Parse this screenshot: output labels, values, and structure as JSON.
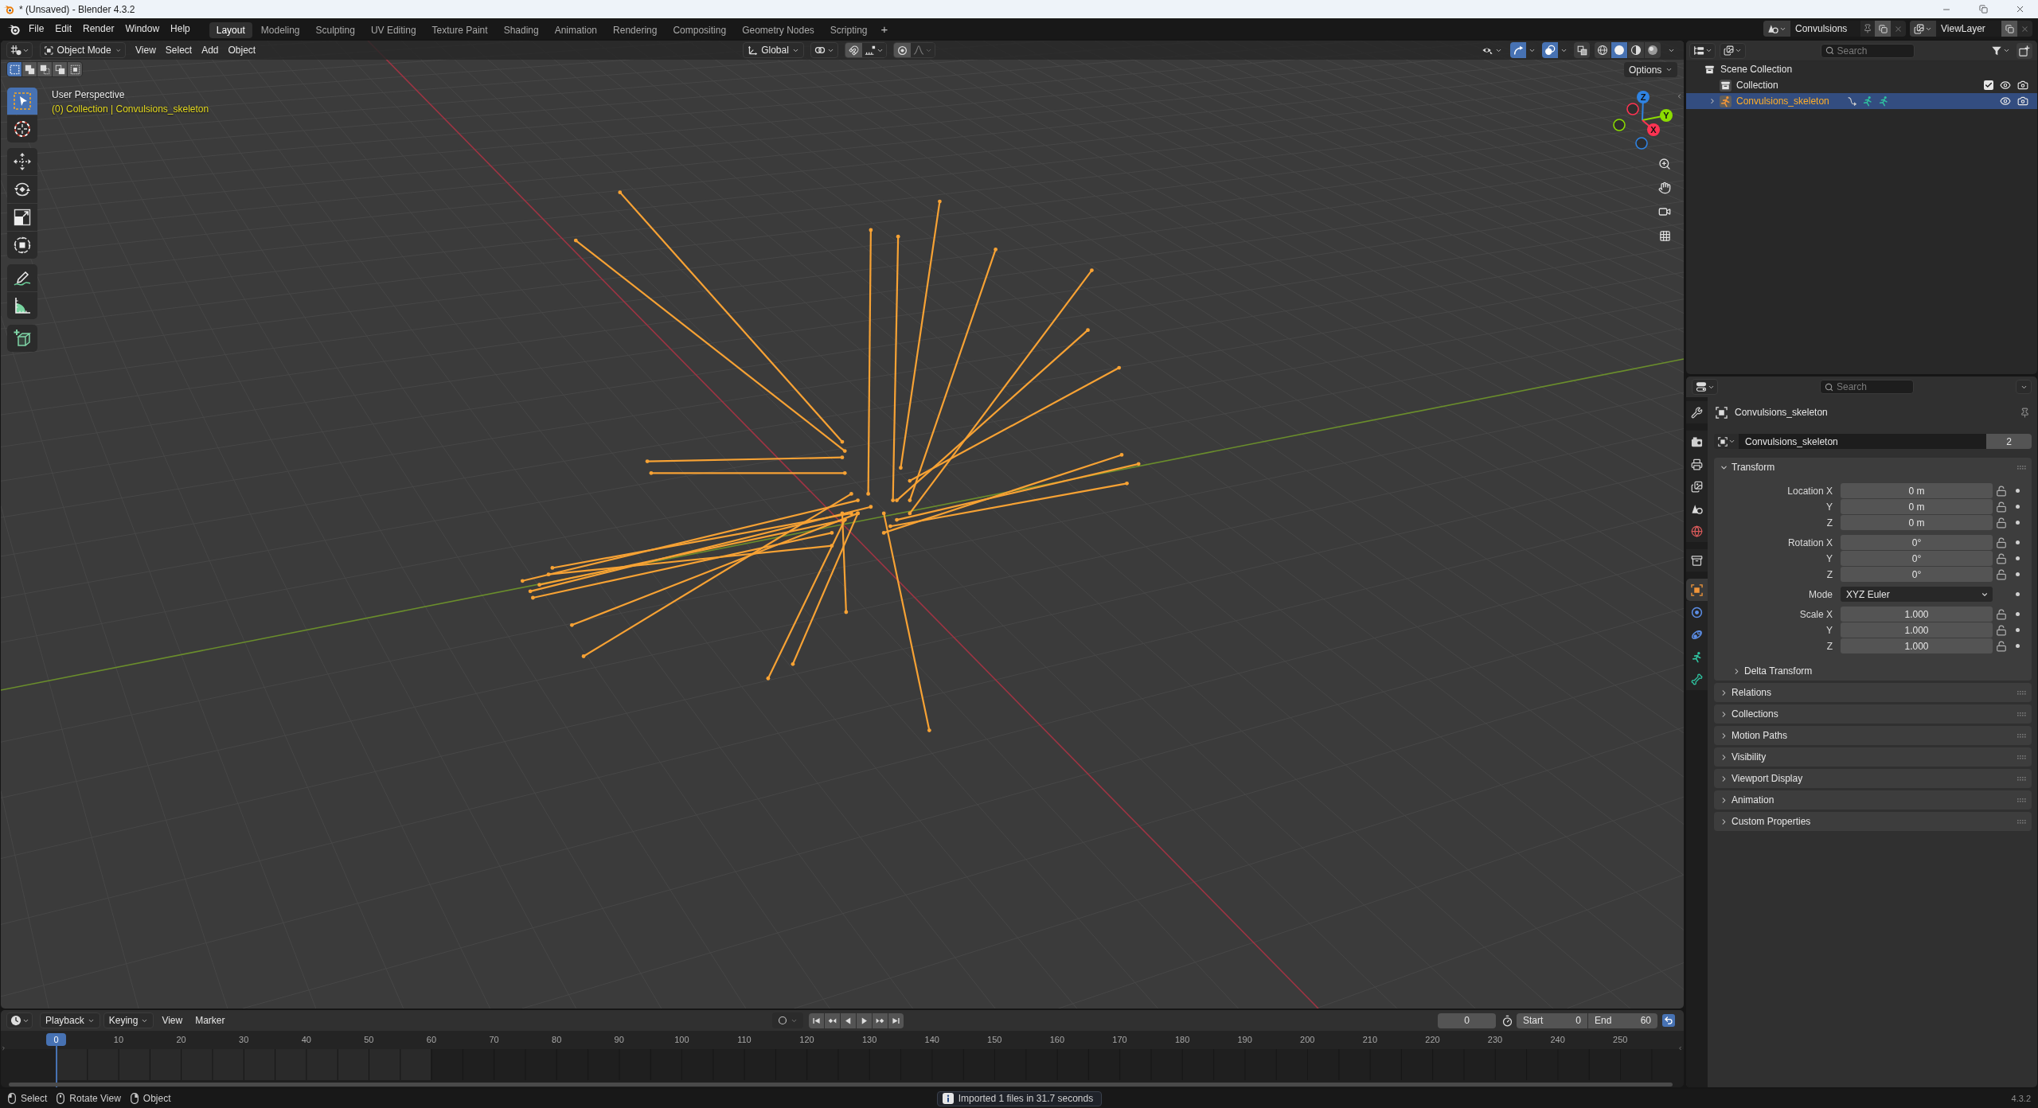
{
  "title_bar": {
    "title": "* (Unsaved) - Blender 4.3.2"
  },
  "top_bar": {
    "menus": [
      "File",
      "Edit",
      "Render",
      "Window",
      "Help"
    ],
    "workspaces": [
      {
        "label": "Layout",
        "selected": true
      },
      {
        "label": "Modeling",
        "selected": false
      },
      {
        "label": "Sculpting",
        "selected": false
      },
      {
        "label": "UV Editing",
        "selected": false
      },
      {
        "label": "Texture Paint",
        "selected": false
      },
      {
        "label": "Shading",
        "selected": false
      },
      {
        "label": "Animation",
        "selected": false
      },
      {
        "label": "Rendering",
        "selected": false
      },
      {
        "label": "Compositing",
        "selected": false
      },
      {
        "label": "Geometry Nodes",
        "selected": false
      },
      {
        "label": "Scripting",
        "selected": false
      }
    ],
    "add_workspace": "+",
    "scene": "Convulsions",
    "view_layer": "ViewLayer"
  },
  "viewport": {
    "header": {
      "mode": "Object Mode",
      "menus": [
        "View",
        "Select",
        "Add",
        "Object"
      ],
      "orientation": "Global",
      "gizmos_on": true,
      "overlays_on": true,
      "shading": [
        {
          "kind": "wireframe",
          "selected": false
        },
        {
          "kind": "solid",
          "selected": true
        },
        {
          "kind": "material",
          "selected": false
        },
        {
          "kind": "rendered",
          "selected": false
        }
      ]
    },
    "selection_modes": [
      {
        "kind": "set",
        "selected": true
      },
      {
        "kind": "extend",
        "selected": false
      },
      {
        "kind": "subtract",
        "selected": false
      },
      {
        "kind": "invert",
        "selected": false
      },
      {
        "kind": "intersect",
        "selected": false
      }
    ],
    "options": "Options",
    "view_name": "User Perspective",
    "context": "(0) Collection | Convulsions_skeleton",
    "tool_groups": [
      {
        "tools": [
          {
            "kind": "select_box",
            "selected": true
          },
          {
            "kind": "cursor",
            "selected": false
          }
        ]
      },
      {
        "tools": [
          {
            "kind": "move",
            "selected": false
          },
          {
            "kind": "rotate",
            "selected": false
          },
          {
            "kind": "scale",
            "selected": false
          },
          {
            "kind": "transform",
            "selected": false
          }
        ]
      },
      {
        "tools": [
          {
            "kind": "annotate",
            "selected": false
          },
          {
            "kind": "measure",
            "selected": false
          }
        ]
      },
      {
        "tools": [
          {
            "kind": "add_cube",
            "selected": false
          }
        ]
      }
    ],
    "gizmo_axes": [
      {
        "label": "Z",
        "color": "#2f83e2"
      },
      {
        "label": "Y",
        "color": "#8bdc00"
      },
      {
        "label": "X",
        "color": "#ff3352"
      }
    ]
  },
  "outliner": {
    "search_placeholder": "Search",
    "tree": [
      {
        "kind": "scene_collection",
        "label": "Scene Collection",
        "selected": false,
        "children": [
          {
            "kind": "collection",
            "label": "Collection",
            "checked": true,
            "selected": false
          },
          {
            "kind": "armature",
            "label": "Convulsions_skeleton",
            "selected": true,
            "expanded": false
          }
        ]
      }
    ]
  },
  "properties": {
    "search_placeholder": "Search",
    "tab_groups": [
      {
        "tabs": [
          {
            "kind": "tool",
            "selected": false
          }
        ]
      },
      {
        "tabs": [
          {
            "kind": "render",
            "selected": false
          },
          {
            "kind": "output",
            "selected": false
          },
          {
            "kind": "view_layer",
            "selected": false
          },
          {
            "kind": "scene",
            "selected": false
          },
          {
            "kind": "world",
            "selected": false
          }
        ]
      },
      {
        "tabs": [
          {
            "kind": "collection",
            "selected": false
          }
        ]
      },
      {
        "tabs": [
          {
            "kind": "object",
            "selected": true
          },
          {
            "kind": "physics",
            "selected": false
          },
          {
            "kind": "constraints",
            "selected": false
          },
          {
            "kind": "armature_data",
            "selected": false
          },
          {
            "kind": "bone",
            "selected": false
          }
        ]
      }
    ],
    "object_name": "Convulsions_skeleton",
    "datablock": {
      "name": "Convulsions_skeleton",
      "users": "2"
    },
    "panels": [
      {
        "title": "Transform",
        "expanded": true,
        "groups": [
          {
            "kind": "number",
            "rows": [
              {
                "label": "Location X",
                "value": "0 m"
              },
              {
                "label": "Y",
                "value": "0 m"
              },
              {
                "label": "Z",
                "value": "0 m"
              }
            ]
          },
          {
            "kind": "number",
            "rows": [
              {
                "label": "Rotation X",
                "value": "0°"
              },
              {
                "label": "Y",
                "value": "0°"
              },
              {
                "label": "Z",
                "value": "0°"
              }
            ]
          },
          {
            "kind": "dropdown",
            "rows": [
              {
                "label": "Mode",
                "value": "XYZ Euler"
              }
            ]
          },
          {
            "kind": "number",
            "rows": [
              {
                "label": "Scale X",
                "value": "1.000"
              },
              {
                "label": "Y",
                "value": "1.000"
              },
              {
                "label": "Z",
                "value": "1.000"
              }
            ]
          }
        ],
        "subpanels": [
          {
            "title": "Delta Transform",
            "expanded": false
          }
        ]
      },
      {
        "title": "Relations",
        "expanded": false
      },
      {
        "title": "Collections",
        "expanded": false
      },
      {
        "title": "Motion Paths",
        "expanded": false
      },
      {
        "title": "Visibility",
        "expanded": false
      },
      {
        "title": "Viewport Display",
        "expanded": false
      },
      {
        "title": "Animation",
        "expanded": false
      },
      {
        "title": "Custom Properties",
        "expanded": false
      }
    ]
  },
  "timeline": {
    "menus": [
      {
        "label": "Playback",
        "kind": "dropdown"
      },
      {
        "label": "Keying",
        "kind": "dropdown"
      },
      {
        "label": "View",
        "kind": "menu"
      },
      {
        "label": "Marker",
        "kind": "menu"
      }
    ],
    "auto_keying": false,
    "current_frame": "0",
    "start_label": "Start",
    "start": "0",
    "end_label": "End",
    "end": "60",
    "playhead_frame": "0",
    "ticks": [
      "10",
      "20",
      "30",
      "40",
      "50",
      "60",
      "70",
      "80",
      "90",
      "100",
      "110",
      "120",
      "130",
      "140",
      "150",
      "160",
      "170",
      "180",
      "190",
      "200",
      "210",
      "220",
      "230",
      "240",
      "250"
    ]
  },
  "status_bar": {
    "hints": [
      {
        "kind": "left_mouse",
        "label": "Select"
      },
      {
        "kind": "middle_mouse",
        "label": "Rotate View"
      },
      {
        "kind": "right_mouse",
        "label": "Object"
      }
    ],
    "message": "Imported 1 files in 31.7 seconds",
    "version": "4.3.2"
  }
}
